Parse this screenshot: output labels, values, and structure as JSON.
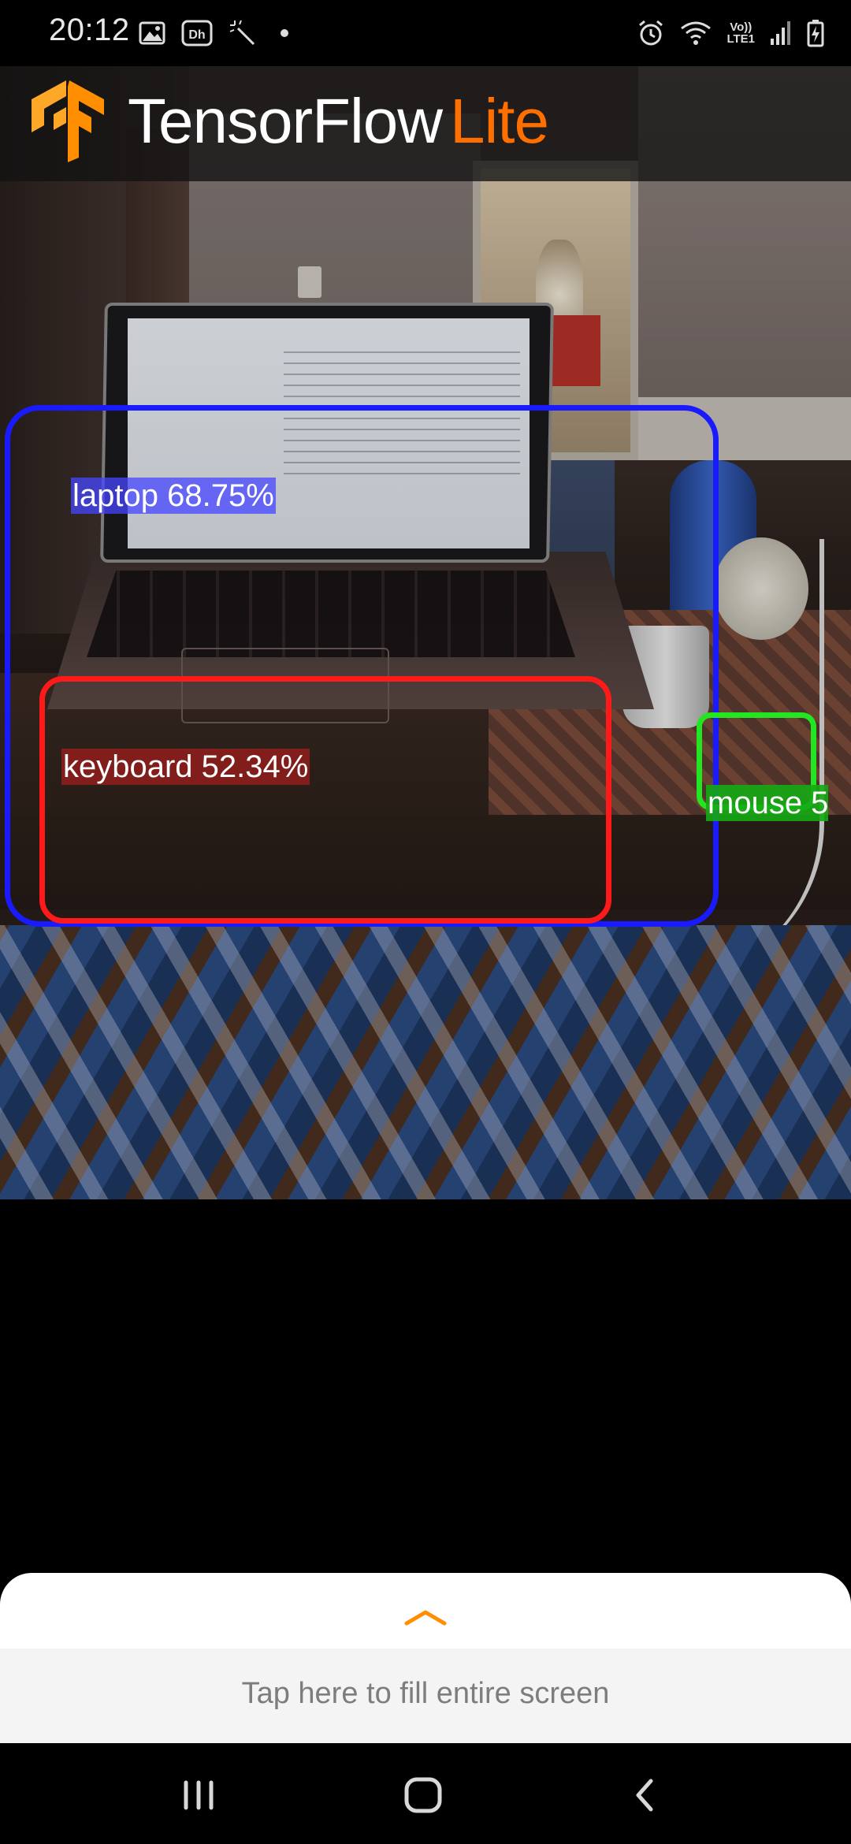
{
  "status_bar": {
    "time": "20:12",
    "left_icons": [
      "gallery-icon",
      "disney-hotstar-icon",
      "magic-wand-icon",
      "notification-dot-icon"
    ],
    "right_icons": [
      "alarm-icon",
      "wifi-calling-icon",
      "volte-icon",
      "signal-icon",
      "battery-charging-icon"
    ],
    "volte_line1": "Vo))",
    "volte_line2": "LTE1"
  },
  "toolbar": {
    "logo": "tensorflow-logo",
    "brand_main": "TensorFlow",
    "brand_accent": "Lite",
    "accent_color": "#ff6f00"
  },
  "detections": [
    {
      "label": "laptop 68.75%",
      "color": "#1a1aff"
    },
    {
      "label": "keyboard 52.34%",
      "color": "#ff1a1a"
    },
    {
      "label": "mouse 5",
      "color": "#22e622"
    }
  ],
  "bottom_sheet": {
    "handle_icon": "chevron-up-icon",
    "hint": "Tap here to fill entire screen"
  },
  "navigation_bar": {
    "buttons": [
      "recent-apps-icon",
      "home-icon",
      "back-icon"
    ]
  }
}
